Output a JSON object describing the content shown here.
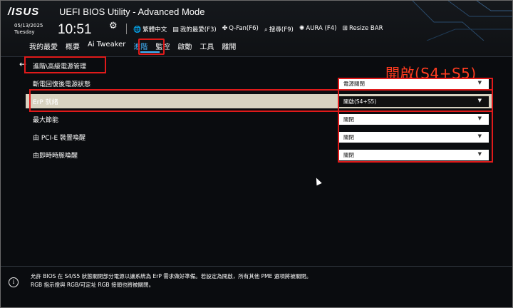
{
  "header": {
    "logo": "/ISUS",
    "title": "UEFI BIOS Utility - Advanced Mode",
    "date": "05/13/2025",
    "weekday": "Tuesday",
    "time": "10:51",
    "tools": [
      {
        "icon": "globe-icon",
        "glyph": "🌐",
        "label": "繁體中文"
      },
      {
        "icon": "bookmark-icon",
        "glyph": "▤",
        "label": "我的最愛(F3)"
      },
      {
        "icon": "fan-icon",
        "glyph": "✤",
        "label": "Q-Fan(F6)"
      },
      {
        "icon": "search-icon",
        "glyph": "⌕",
        "label": "搜尋(F9)"
      },
      {
        "icon": "aura-icon",
        "glyph": "✺",
        "label": "AURA (F4)"
      },
      {
        "icon": "resize-bar-icon",
        "glyph": "⊞",
        "label": "Resize BAR"
      }
    ]
  },
  "tabs": [
    "我的最愛",
    "概要",
    "Ai Tweaker",
    "進階",
    "監控",
    "啟動",
    "工具",
    "離開"
  ],
  "active_tab": "進階",
  "breadcrumb": "進階\\高級電源管理",
  "callout": "開啟(S4+S5)",
  "settings": [
    {
      "label": "斷電回復後電源狀態",
      "value": "電源關閉"
    },
    {
      "label": "ErP 就緒",
      "value": "開啟(S4+S5)"
    },
    {
      "label": "最大節能",
      "value": "關閉"
    },
    {
      "label": "由 PCI-E 裝置喚醒",
      "value": "關閉"
    },
    {
      "label": "由即時時脈喚醒",
      "value": "關閉"
    }
  ],
  "help": {
    "line1": "允許 BIOS 在 S4/S5 狀態關閉部分電源以讓系統為 ErP 需求做好準備。若設定為開啟，所有其他 PME 選項將被關閉。",
    "line2": "RGB 指示燈與 RGB/可定址 RGB 接頭也將被關閉。"
  },
  "colors": {
    "accent": "#43b6ff",
    "highlight": "#e01a1a",
    "callout": "#ff3b1f",
    "selected_row": "#d7d2c0"
  }
}
